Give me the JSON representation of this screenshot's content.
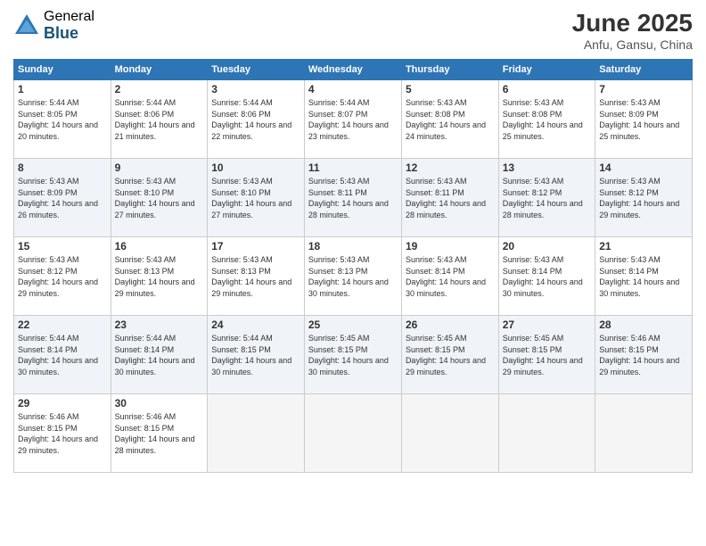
{
  "header": {
    "logo_general": "General",
    "logo_blue": "Blue",
    "month_title": "June 2025",
    "location": "Anfu, Gansu, China"
  },
  "days_of_week": [
    "Sunday",
    "Monday",
    "Tuesday",
    "Wednesday",
    "Thursday",
    "Friday",
    "Saturday"
  ],
  "weeks": [
    {
      "days": [
        {
          "num": "1",
          "sunrise": "5:44 AM",
          "sunset": "8:05 PM",
          "daylight": "14 hours and 20 minutes."
        },
        {
          "num": "2",
          "sunrise": "5:44 AM",
          "sunset": "8:06 PM",
          "daylight": "14 hours and 21 minutes."
        },
        {
          "num": "3",
          "sunrise": "5:44 AM",
          "sunset": "8:06 PM",
          "daylight": "14 hours and 22 minutes."
        },
        {
          "num": "4",
          "sunrise": "5:44 AM",
          "sunset": "8:07 PM",
          "daylight": "14 hours and 23 minutes."
        },
        {
          "num": "5",
          "sunrise": "5:43 AM",
          "sunset": "8:08 PM",
          "daylight": "14 hours and 24 minutes."
        },
        {
          "num": "6",
          "sunrise": "5:43 AM",
          "sunset": "8:08 PM",
          "daylight": "14 hours and 25 minutes."
        },
        {
          "num": "7",
          "sunrise": "5:43 AM",
          "sunset": "8:09 PM",
          "daylight": "14 hours and 25 minutes."
        }
      ]
    },
    {
      "days": [
        {
          "num": "8",
          "sunrise": "5:43 AM",
          "sunset": "8:09 PM",
          "daylight": "14 hours and 26 minutes."
        },
        {
          "num": "9",
          "sunrise": "5:43 AM",
          "sunset": "8:10 PM",
          "daylight": "14 hours and 27 minutes."
        },
        {
          "num": "10",
          "sunrise": "5:43 AM",
          "sunset": "8:10 PM",
          "daylight": "14 hours and 27 minutes."
        },
        {
          "num": "11",
          "sunrise": "5:43 AM",
          "sunset": "8:11 PM",
          "daylight": "14 hours and 28 minutes."
        },
        {
          "num": "12",
          "sunrise": "5:43 AM",
          "sunset": "8:11 PM",
          "daylight": "14 hours and 28 minutes."
        },
        {
          "num": "13",
          "sunrise": "5:43 AM",
          "sunset": "8:12 PM",
          "daylight": "14 hours and 28 minutes."
        },
        {
          "num": "14",
          "sunrise": "5:43 AM",
          "sunset": "8:12 PM",
          "daylight": "14 hours and 29 minutes."
        }
      ]
    },
    {
      "days": [
        {
          "num": "15",
          "sunrise": "5:43 AM",
          "sunset": "8:12 PM",
          "daylight": "14 hours and 29 minutes."
        },
        {
          "num": "16",
          "sunrise": "5:43 AM",
          "sunset": "8:13 PM",
          "daylight": "14 hours and 29 minutes."
        },
        {
          "num": "17",
          "sunrise": "5:43 AM",
          "sunset": "8:13 PM",
          "daylight": "14 hours and 29 minutes."
        },
        {
          "num": "18",
          "sunrise": "5:43 AM",
          "sunset": "8:13 PM",
          "daylight": "14 hours and 30 minutes."
        },
        {
          "num": "19",
          "sunrise": "5:43 AM",
          "sunset": "8:14 PM",
          "daylight": "14 hours and 30 minutes."
        },
        {
          "num": "20",
          "sunrise": "5:43 AM",
          "sunset": "8:14 PM",
          "daylight": "14 hours and 30 minutes."
        },
        {
          "num": "21",
          "sunrise": "5:43 AM",
          "sunset": "8:14 PM",
          "daylight": "14 hours and 30 minutes."
        }
      ]
    },
    {
      "days": [
        {
          "num": "22",
          "sunrise": "5:44 AM",
          "sunset": "8:14 PM",
          "daylight": "14 hours and 30 minutes."
        },
        {
          "num": "23",
          "sunrise": "5:44 AM",
          "sunset": "8:14 PM",
          "daylight": "14 hours and 30 minutes."
        },
        {
          "num": "24",
          "sunrise": "5:44 AM",
          "sunset": "8:15 PM",
          "daylight": "14 hours and 30 minutes."
        },
        {
          "num": "25",
          "sunrise": "5:45 AM",
          "sunset": "8:15 PM",
          "daylight": "14 hours and 30 minutes."
        },
        {
          "num": "26",
          "sunrise": "5:45 AM",
          "sunset": "8:15 PM",
          "daylight": "14 hours and 29 minutes."
        },
        {
          "num": "27",
          "sunrise": "5:45 AM",
          "sunset": "8:15 PM",
          "daylight": "14 hours and 29 minutes."
        },
        {
          "num": "28",
          "sunrise": "5:46 AM",
          "sunset": "8:15 PM",
          "daylight": "14 hours and 29 minutes."
        }
      ]
    },
    {
      "days": [
        {
          "num": "29",
          "sunrise": "5:46 AM",
          "sunset": "8:15 PM",
          "daylight": "14 hours and 29 minutes."
        },
        {
          "num": "30",
          "sunrise": "5:46 AM",
          "sunset": "8:15 PM",
          "daylight": "14 hours and 28 minutes."
        },
        null,
        null,
        null,
        null,
        null
      ]
    }
  ]
}
